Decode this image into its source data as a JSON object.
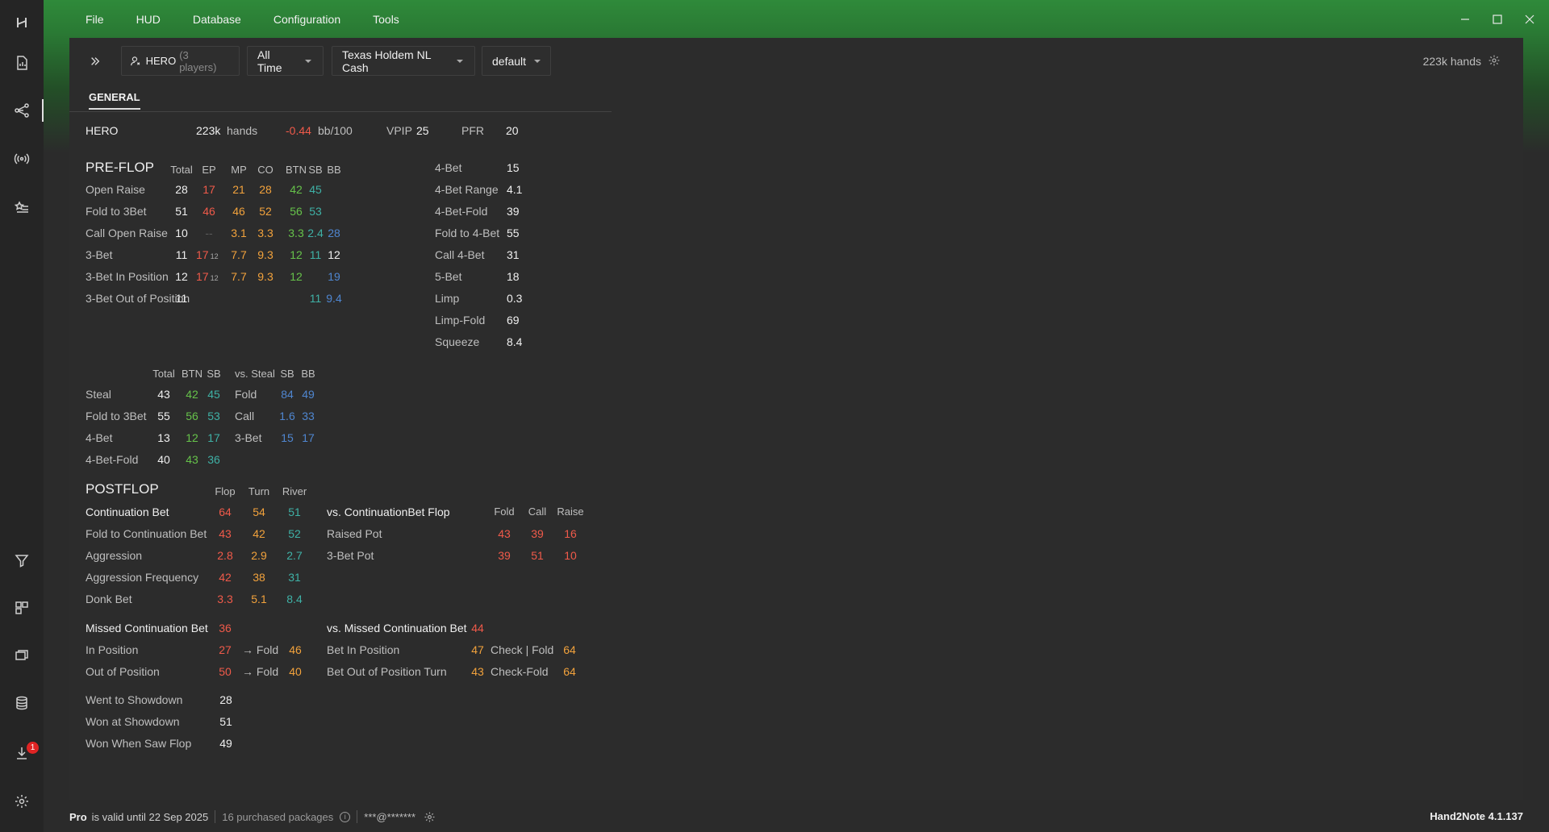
{
  "menu": [
    "File",
    "HUD",
    "Database",
    "Configuration",
    "Tools"
  ],
  "toolbar": {
    "player": "HERO",
    "player_count": "(3 players)",
    "period": "All Time",
    "game": "Texas Holdem NL Cash",
    "profile": "default",
    "hands_total": "223k hands"
  },
  "tab": "GENERAL",
  "summary": {
    "name": "HERO",
    "hands": "223k",
    "hands_label": "hands",
    "bb100": "-0.44",
    "bb100_label": "bb/100",
    "vpip_label": "VPIP",
    "vpip": "25",
    "pfr_label": "PFR",
    "pfr": "20"
  },
  "preflop": {
    "title": "PRE-FLOP",
    "headers": [
      "Total",
      "EP",
      "MP",
      "CO",
      "BTN",
      "SB",
      "BB"
    ],
    "rows": [
      {
        "label": "Open Raise",
        "cells": [
          "28",
          "17",
          "21",
          "28",
          "42",
          "45",
          ""
        ]
      },
      {
        "label": "Fold to 3Bet",
        "cells": [
          "51",
          "46",
          "46",
          "52",
          "56",
          "53",
          ""
        ]
      },
      {
        "label": "Call Open Raise",
        "cells": [
          "10",
          "--",
          "3.1",
          "3.3",
          "3.3",
          "2.4",
          "28"
        ]
      },
      {
        "label": "3-Bet",
        "cells": [
          "11",
          "17",
          "7.7",
          "9.3",
          "12",
          "11",
          "12"
        ],
        "sub": "12"
      },
      {
        "label": "3-Bet In Position",
        "cells": [
          "12",
          "17",
          "7.7",
          "9.3",
          "12",
          "",
          "19"
        ],
        "sub": "12"
      },
      {
        "label": "3-Bet Out of Position",
        "cells": [
          "11",
          "",
          "",
          "",
          "",
          "11",
          "9.4"
        ]
      }
    ],
    "side": [
      {
        "label": "4-Bet",
        "value": "15"
      },
      {
        "label": "4-Bet Range",
        "value": "4.1"
      },
      {
        "label": "4-Bet-Fold",
        "value": "39"
      },
      {
        "label": "Fold to 4-Bet",
        "value": "55"
      },
      {
        "label": "Call 4-Bet",
        "value": "31"
      },
      {
        "label": "5-Bet",
        "value": "18"
      },
      {
        "label": "Limp",
        "value": "0.3"
      },
      {
        "label": "Limp-Fold",
        "value": "69"
      },
      {
        "label": "Squeeze",
        "value": "8.4"
      }
    ]
  },
  "steal": {
    "headers": [
      "Total",
      "BTN",
      "SB"
    ],
    "vs_headers": [
      "vs. Steal",
      "SB",
      "BB"
    ],
    "rows": [
      {
        "label": "Steal",
        "cells": [
          "43",
          "42",
          "45"
        ],
        "vs_label": "Fold",
        "vs_cells": [
          "84",
          "49"
        ]
      },
      {
        "label": "Fold to 3Bet",
        "cells": [
          "55",
          "56",
          "53"
        ],
        "vs_label": "Call",
        "vs_cells": [
          "1.6",
          "33"
        ]
      },
      {
        "label": "4-Bet",
        "cells": [
          "13",
          "12",
          "17"
        ],
        "vs_label": "3-Bet",
        "vs_cells": [
          "15",
          "17"
        ]
      },
      {
        "label": "4-Bet-Fold",
        "cells": [
          "40",
          "43",
          "36"
        ],
        "vs_label": "",
        "vs_cells": [
          "",
          ""
        ]
      }
    ]
  },
  "postflop": {
    "title": "POSTFLOP",
    "headers": [
      "Flop",
      "Turn",
      "River"
    ],
    "rows": [
      {
        "label": "Continuation Bet",
        "cells": [
          "64",
          "54",
          "51"
        ]
      },
      {
        "label": "Fold to Continuation Bet",
        "cells": [
          "43",
          "42",
          "52"
        ]
      },
      {
        "label": "Aggression",
        "cells": [
          "2.8",
          "2.9",
          "2.7"
        ]
      },
      {
        "label": "Aggression Frequency",
        "cells": [
          "42",
          "38",
          "31"
        ]
      },
      {
        "label": "Donk Bet",
        "cells": [
          "3.3",
          "5.1",
          "8.4"
        ]
      }
    ],
    "vs_cbet": {
      "title": "vs. ContinuationBet Flop",
      "headers": [
        "Fold",
        "Call",
        "Raise"
      ],
      "rows": [
        {
          "label": "Raised Pot",
          "cells": [
            "43",
            "39",
            "16"
          ]
        },
        {
          "label": "3-Bet Pot",
          "cells": [
            "39",
            "51",
            "10"
          ]
        }
      ]
    },
    "missed": {
      "title": "Missed Continuation Bet",
      "value": "36",
      "rows": [
        {
          "label": "In Position",
          "value": "27",
          "arrow": "→ Fold",
          "fold": "46"
        },
        {
          "label": "Out of Position",
          "value": "50",
          "arrow": "→ Fold",
          "fold": "40"
        }
      ]
    },
    "vs_missed": {
      "title": "vs. Missed Continuation Bet",
      "value": "44",
      "rows": [
        {
          "label": "Bet In Position",
          "value": "47",
          "label2": "Check | Fold",
          "value2": "64"
        },
        {
          "label": "Bet Out of Position Turn",
          "value": "43",
          "label2": "Check-Fold",
          "value2": "64"
        }
      ]
    },
    "showdown": [
      {
        "label": "Went to Showdown",
        "value": "28"
      },
      {
        "label": "Won at Showdown",
        "value": "51"
      },
      {
        "label": "Won When Saw Flop",
        "value": "49"
      }
    ]
  },
  "status": {
    "plan": "Pro",
    "valid": "is valid until 22 Sep 2025",
    "packages": "16 purchased packages",
    "email": "***@*******",
    "version": "Hand2Note 4.1.137"
  },
  "notifications": "1",
  "colors": {
    "accent_green": "#2f8a3a",
    "red": "#f05a4a",
    "orange": "#f2a23c",
    "green": "#66c24a",
    "teal": "#3fb1a6",
    "blue": "#4f86d0"
  }
}
